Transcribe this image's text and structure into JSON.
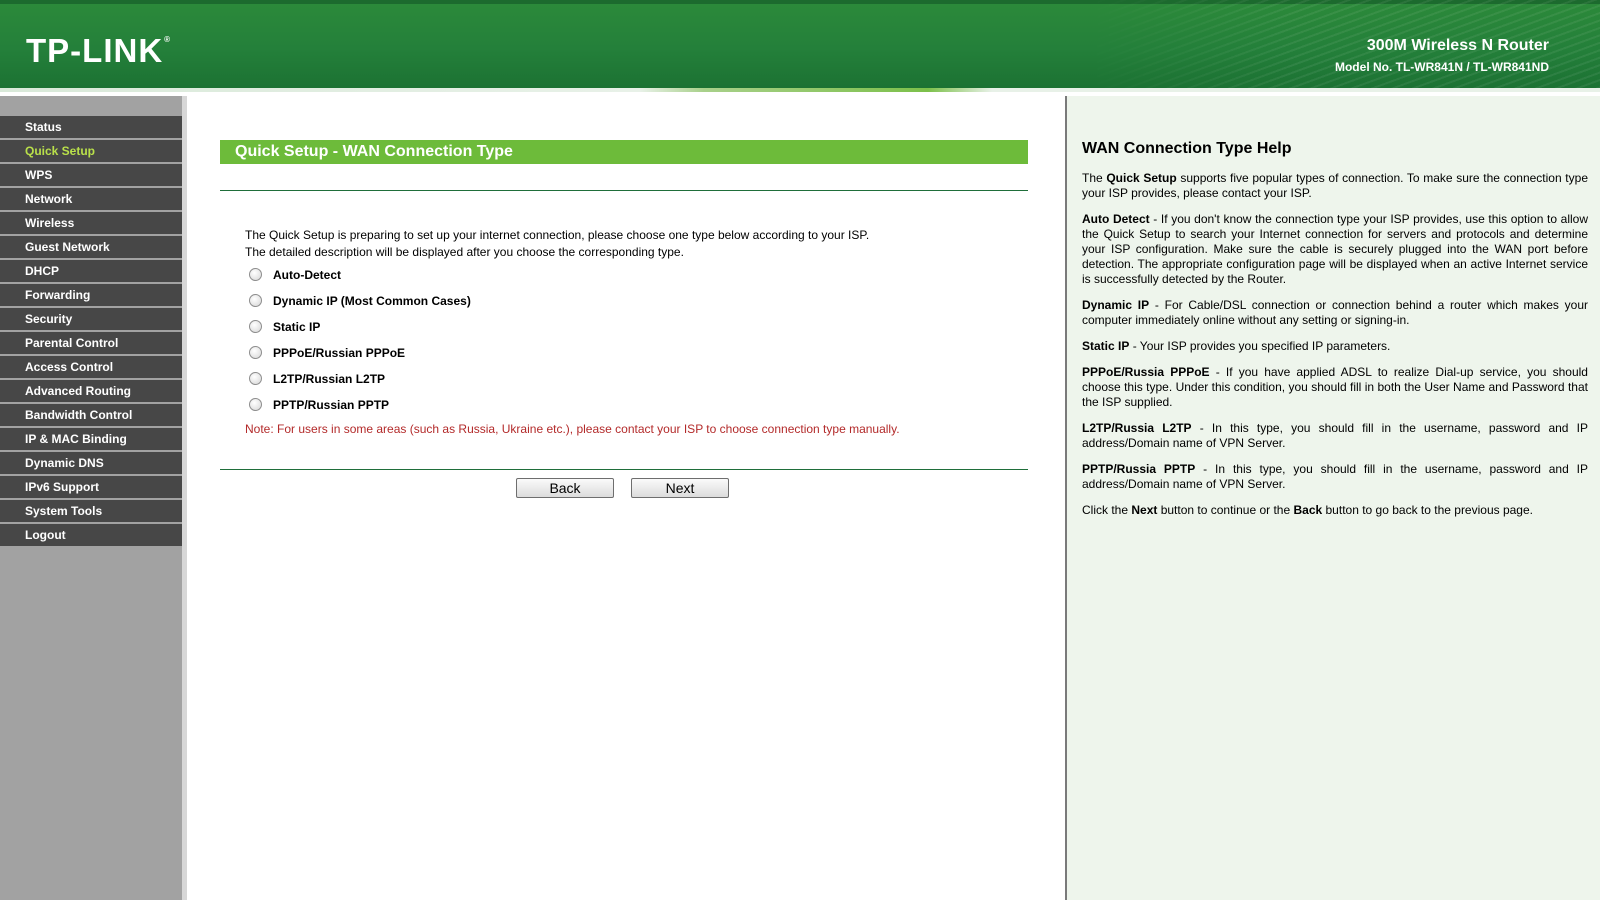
{
  "header": {
    "logo": "TP-LINK",
    "logo_mark": "®",
    "product": "300M Wireless N Router",
    "model": "Model No. TL-WR841N / TL-WR841ND"
  },
  "sidebar": {
    "items": [
      {
        "label": "Status",
        "active": false
      },
      {
        "label": "Quick Setup",
        "active": true
      },
      {
        "label": "WPS",
        "active": false
      },
      {
        "label": "Network",
        "active": false
      },
      {
        "label": "Wireless",
        "active": false
      },
      {
        "label": "Guest Network",
        "active": false
      },
      {
        "label": "DHCP",
        "active": false
      },
      {
        "label": "Forwarding",
        "active": false
      },
      {
        "label": "Security",
        "active": false
      },
      {
        "label": "Parental Control",
        "active": false
      },
      {
        "label": "Access Control",
        "active": false
      },
      {
        "label": "Advanced Routing",
        "active": false
      },
      {
        "label": "Bandwidth Control",
        "active": false
      },
      {
        "label": "IP & MAC Binding",
        "active": false
      },
      {
        "label": "Dynamic DNS",
        "active": false
      },
      {
        "label": "IPv6 Support",
        "active": false
      },
      {
        "label": "System Tools",
        "active": false
      },
      {
        "label": "Logout",
        "active": false
      }
    ]
  },
  "main": {
    "title": "Quick Setup - WAN Connection Type",
    "intro_line1": "The Quick Setup is preparing to set up your internet connection, please choose one type below according to your ISP.",
    "intro_line2": "The detailed description will be displayed after you choose the corresponding type.",
    "options": [
      {
        "label": "Auto-Detect",
        "checked": false
      },
      {
        "label": "Dynamic IP (Most Common Cases)",
        "checked": false
      },
      {
        "label": "Static IP",
        "checked": false
      },
      {
        "label": "PPPoE/Russian PPPoE",
        "checked": false
      },
      {
        "label": "L2TP/Russian L2TP",
        "checked": false
      },
      {
        "label": "PPTP/Russian PPTP",
        "checked": false
      }
    ],
    "note": "Note: For users in some areas (such as Russia, Ukraine etc.), please contact your ISP to choose connection type manually.",
    "back_label": "Back",
    "next_label": "Next"
  },
  "help": {
    "title": "WAN Connection Type Help",
    "p1": {
      "pre": "The ",
      "b1": "Quick Setup",
      "post": " supports five popular types of connection. To make sure the connection type your ISP provides, please contact your ISP."
    },
    "p2": {
      "term": "Auto Detect",
      "text": " - If you don't know the connection type your ISP provides, use this option to allow the Quick Setup to search your Internet connection for servers and protocols and determine your ISP configuration. Make sure the cable is securely plugged into the WAN port before detection. The appropriate configuration page will be displayed when an active Internet service is successfully detected by the Router."
    },
    "p3": {
      "term": "Dynamic IP",
      "text": " - For Cable/DSL connection or connection behind a router which makes your computer immediately online without any setting or signing-in."
    },
    "p4": {
      "term": "Static IP",
      "text": " - Your ISP provides you specified IP parameters."
    },
    "p5": {
      "term": "PPPoE/Russia PPPoE",
      "text": " - If you have applied ADSL to realize Dial-up service, you should choose this type. Under this condition, you should fill in both the User Name and Password that the ISP supplied."
    },
    "p6": {
      "term": "L2TP/Russia L2TP",
      "text": " - In this type, you should fill in the username, password and IP address/Domain name of VPN Server."
    },
    "p7": {
      "term": "PPTP/Russia PPTP",
      "text": " - In this type, you should fill in the username, password and IP address/Domain name of VPN Server."
    },
    "p8": {
      "pre": "Click the ",
      "b1": "Next",
      "mid": " button to continue or the ",
      "b2": "Back",
      "post": " button to go back to the previous page."
    }
  },
  "colors": {
    "header_green": "#24803a",
    "title_bar_green": "#6dbb3a",
    "active_nav": "#b9e04a",
    "nav_bg": "#474747",
    "sidebar_bg": "#a2a2a2",
    "note_red": "#b32a2a",
    "help_bg": "#eef5ec"
  }
}
